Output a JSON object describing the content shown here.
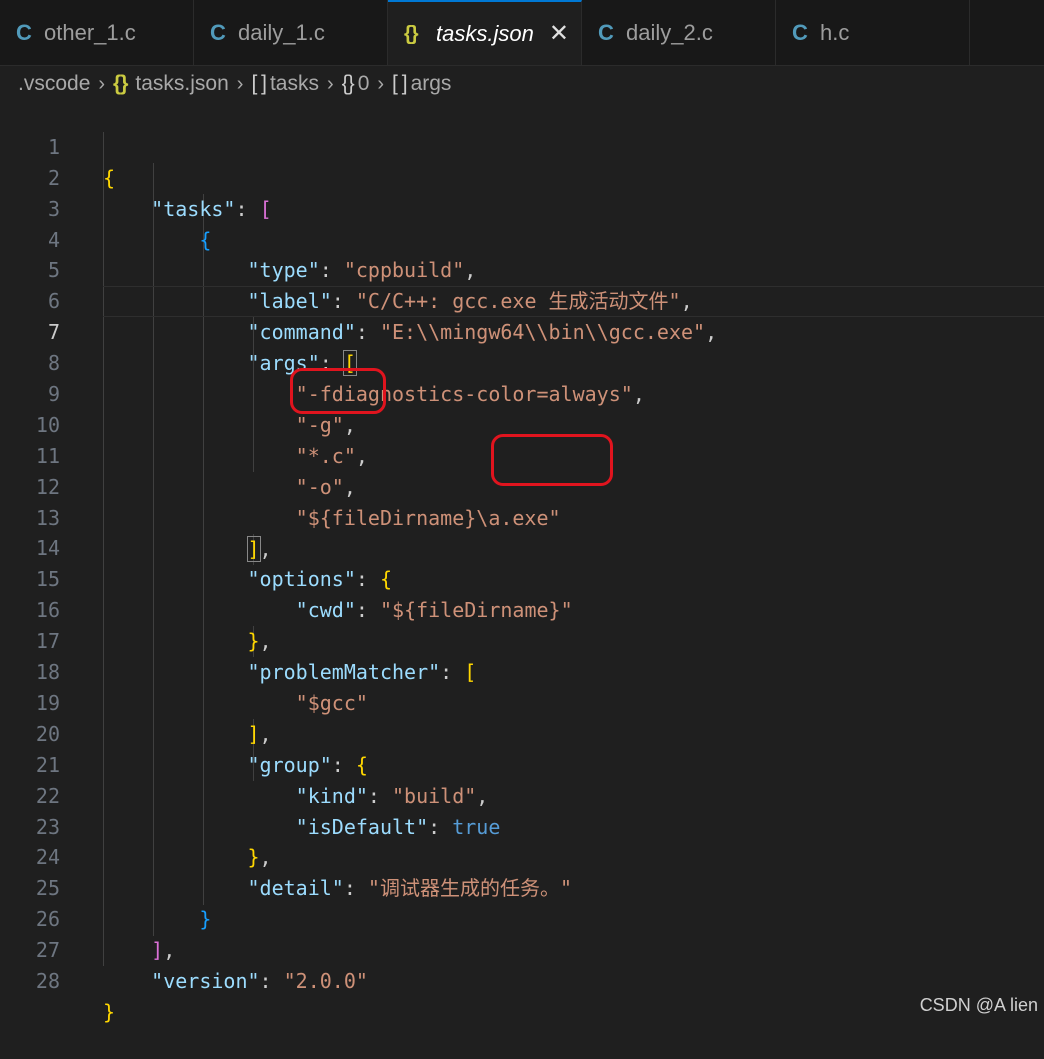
{
  "tabs": [
    {
      "icon": "C",
      "label": "other_1.c"
    },
    {
      "icon": "C",
      "label": "daily_1.c"
    },
    {
      "icon": "{}",
      "label": "tasks.json",
      "active": true
    },
    {
      "icon": "C",
      "label": "daily_2.c"
    },
    {
      "icon": "C",
      "label": "h.c"
    }
  ],
  "close_glyph": "✕",
  "breadcrumb": {
    "folder": ".vscode",
    "file_icon": "{}",
    "file": "tasks.json",
    "seg1_icon": "[ ]",
    "seg1": "tasks",
    "seg2_icon": "{}",
    "seg2": "0",
    "seg3_icon": "[ ]",
    "seg3": "args",
    "sep": "›"
  },
  "editor": {
    "current_line": 7,
    "line_numbers": [
      "1",
      "2",
      "3",
      "4",
      "5",
      "6",
      "7",
      "8",
      "9",
      "10",
      "11",
      "12",
      "13",
      "14",
      "15",
      "16",
      "17",
      "18",
      "19",
      "20",
      "21",
      "22",
      "23",
      "24",
      "25",
      "26",
      "27",
      "28"
    ],
    "tokens": {
      "tasks_key": "\"tasks\"",
      "type_key": "\"type\"",
      "type_val": "\"cppbuild\"",
      "label_key": "\"label\"",
      "label_val": "\"C/C++: gcc.exe 生成活动文件\"",
      "command_key": "\"command\"",
      "command_val": "\"E:\\\\mingw64\\\\bin\\\\gcc.exe\"",
      "args_key": "\"args\"",
      "arg1": "\"-fdiagnostics-color=always\"",
      "arg2": "\"-g\"",
      "arg3": "\"*.c\"",
      "arg4": "\"-o\"",
      "arg5": "\"${fileDirname}\\a.exe\"",
      "options_key": "\"options\"",
      "cwd_key": "\"cwd\"",
      "cwd_val": "\"${fileDirname}\"",
      "pm_key": "\"problemMatcher\"",
      "pm_val": "\"$gcc\"",
      "group_key": "\"group\"",
      "kind_key": "\"kind\"",
      "kind_val": "\"build\"",
      "isdefault_key": "\"isDefault\"",
      "isdefault_val": "true",
      "detail_key": "\"detail\"",
      "detail_val": "\"调试器生成的任务。\"",
      "version_key": "\"version\"",
      "version_val": "\"2.0.0\""
    }
  },
  "colors": {
    "background": "#1f1f1f",
    "json_key": "#9cdcfe",
    "json_string": "#ce9178",
    "json_keyword": "#569cd6",
    "bracket_gold": "#ffd700",
    "bracket_violet": "#da70d6",
    "bracket_blue": "#179fff",
    "annotation_red": "#e0141e"
  },
  "watermark": "CSDN @A lien"
}
